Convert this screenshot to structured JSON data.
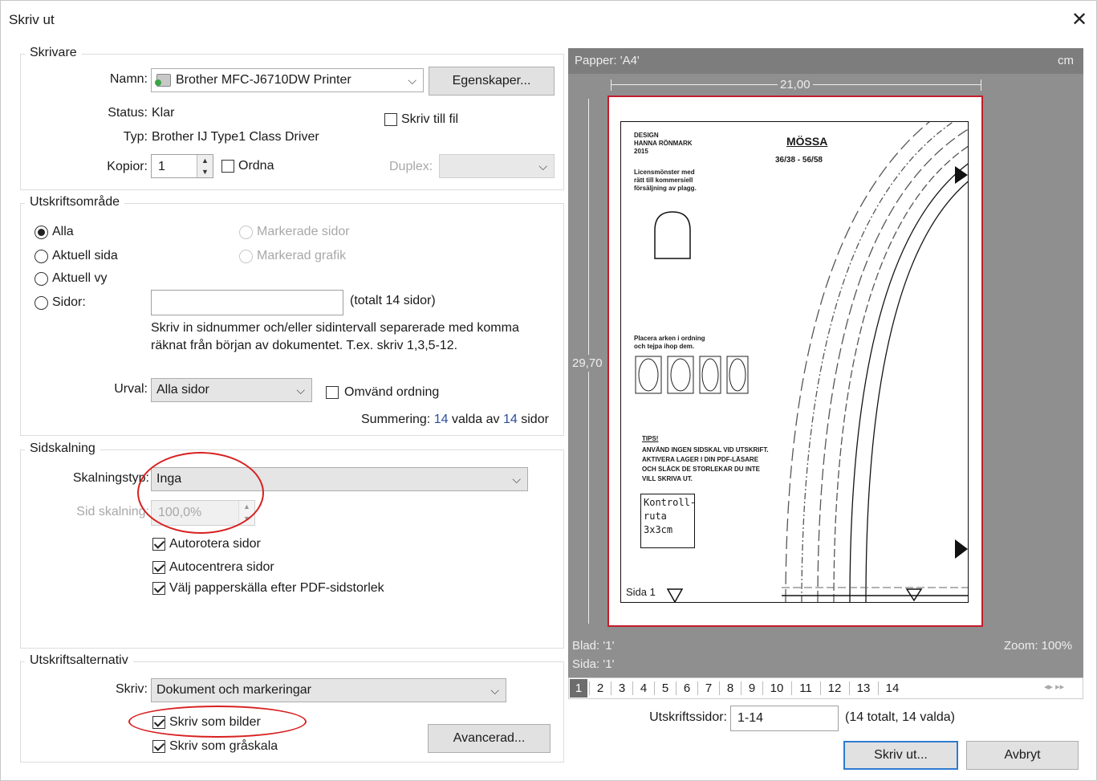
{
  "window": {
    "title": "Skriv ut"
  },
  "printer": {
    "legend": "Skrivare",
    "name_label": "Namn:",
    "name_value": "Brother MFC-J6710DW Printer",
    "properties_button": "Egenskaper...",
    "status_label": "Status:",
    "status_value": "Klar",
    "type_label": "Typ:",
    "type_value": "Brother IJ Type1 Class Driver",
    "print_to_file": "Skriv till fil",
    "copies_label": "Kopior:",
    "copies_value": "1",
    "collate": "Ordna",
    "duplex_label": "Duplex:"
  },
  "range": {
    "legend": "Utskriftsområde",
    "all": "Alla",
    "current_page": "Aktuell sida",
    "current_view": "Aktuell vy",
    "pages": "Sidor:",
    "selected_pages": "Markerade sidor",
    "selected_graphic": "Markerad grafik",
    "total_pages": "(totalt 14 sidor)",
    "help_line1": "Skriv in sidnummer och/eller sidintervall separerade med komma",
    "help_line2": "räknat från början av dokumentet. T.ex. skriv 1,3,5-12.",
    "subset_label": "Urval:",
    "subset_value": "Alla sidor",
    "reverse": "Omvänd ordning",
    "summary_prefix": "Summering:",
    "summary_selected": "14",
    "summary_mid": "valda av",
    "summary_total": "14",
    "summary_suffix": "sidor"
  },
  "scaling": {
    "legend": "Sidskalning",
    "type_label": "Skalningstyp:",
    "type_value": "Inga",
    "scale_label": "Sid skalning:",
    "scale_value": "100,0%",
    "auto_rotate": "Autorotera sidor",
    "auto_center": "Autocentrera sidor",
    "paper_source": "Välj papperskälla efter PDF-sidstorlek"
  },
  "options": {
    "legend": "Utskriftsalternativ",
    "print_label": "Skriv:",
    "print_value": "Dokument och markeringar",
    "as_image": "Skriv som bilder",
    "grayscale": "Skriv som gråskala",
    "advanced_button": "Avancerad..."
  },
  "preview": {
    "paper": "Papper: 'A4'",
    "unit": "cm",
    "width": "21,00",
    "height": "29,70",
    "sheet": "Blad: '1'",
    "page": "Sida: '1'",
    "zoom": "Zoom: 100%",
    "page_numbers": [
      "1",
      "2",
      "3",
      "4",
      "5",
      "6",
      "7",
      "8",
      "9",
      "10",
      "11",
      "12",
      "13",
      "14"
    ],
    "content": {
      "design_lines": [
        "DESIGN",
        "HANNA RÖNMARK",
        "2015"
      ],
      "license_lines": [
        "Licensmönster med",
        "rätt till kommersiell",
        "försäljning av plagg."
      ],
      "title": "MÖSSA",
      "sizes": "36/38 - 56/58",
      "placement_lines": [
        "Placera arken i ordning",
        "och tejpa ihop dem."
      ],
      "tips_title": "TIPS!",
      "tips_lines": [
        "ANVÄND INGEN SIDSKAL VID UTSKRIFT.",
        "AKTIVERA LAGER I DIN PDF-LÄSARE",
        "OCH SLÄCK DE STORLEKAR DU INTE",
        "VILL SKRIVA UT."
      ],
      "control_box": [
        "Kontroll-",
        "ruta",
        "3x3cm"
      ],
      "page_label": "Sida 1"
    }
  },
  "footer": {
    "print_pages_label": "Utskriftssidor:",
    "print_pages_value": "1-14",
    "print_pages_info": "(14 totalt, 14 valda)",
    "print_button": "Skriv ut...",
    "cancel_button": "Avbryt"
  },
  "colors": {
    "accent": "#2f7bd0",
    "annotation": "#d82020",
    "link_number": "#2b4c9c"
  }
}
